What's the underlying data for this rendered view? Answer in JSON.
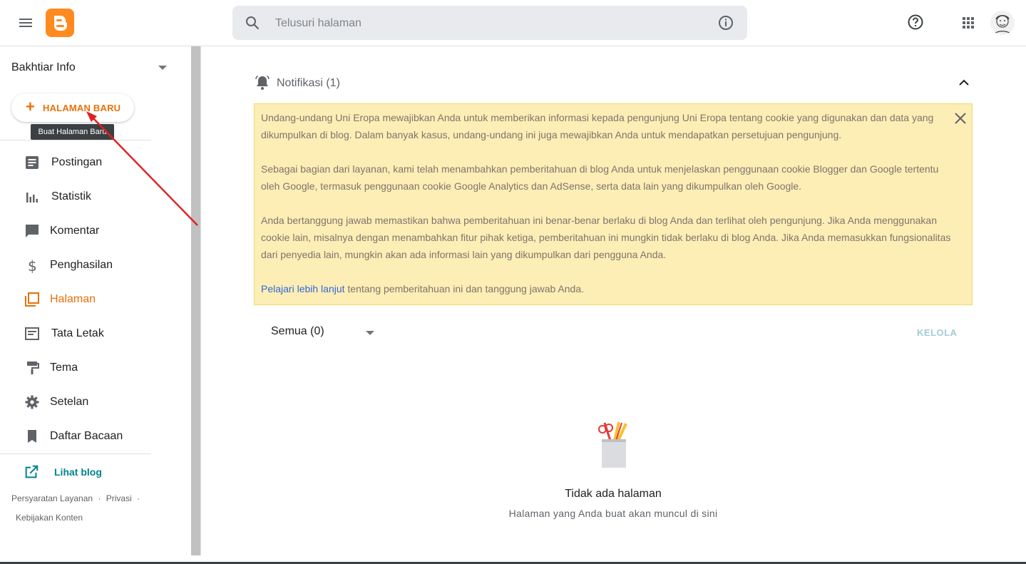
{
  "header": {
    "search_placeholder": "Telusuri halaman",
    "icons": [
      "menu-icon",
      "blogger-logo",
      "search-icon",
      "info-icon",
      "help-icon",
      "apps-icon",
      "avatar"
    ]
  },
  "sidebar": {
    "blog_name": "Bakhtiar Info",
    "new_page_label": "HALAMAN BARU",
    "tooltip": "Buat Halaman Baru",
    "items": [
      {
        "label": "Postingan",
        "icon": "posts-icon"
      },
      {
        "label": "Statistik",
        "icon": "stats-icon"
      },
      {
        "label": "Komentar",
        "icon": "comment-icon"
      },
      {
        "label": "Penghasilan",
        "icon": "dollar-icon"
      },
      {
        "label": "Halaman",
        "icon": "pages-icon"
      },
      {
        "label": "Tata Letak",
        "icon": "layout-icon"
      },
      {
        "label": "Tema",
        "icon": "paint-roller-icon"
      },
      {
        "label": "Setelan",
        "icon": "gear-icon"
      },
      {
        "label": "Daftar Bacaan",
        "icon": "bookmark-icon"
      }
    ],
    "active_item": "Halaman",
    "view_blog": "Lihat blog",
    "footer": {
      "terms": "Persyaratan Layanan",
      "privacy": "Privasi",
      "content_policy": "Kebijakan Konten",
      "sep": "·"
    }
  },
  "main": {
    "notifications_title": "Notifikasi (1)",
    "notice": {
      "p1": "Undang-undang Uni Eropa mewajibkan Anda untuk memberikan informasi kepada pengunjung Uni Eropa tentang cookie yang digunakan dan data yang dikumpulkan di blog. Dalam banyak kasus, undang-undang ini juga mewajibkan Anda untuk mendapatkan persetujuan pengunjung.",
      "p2": "Sebagai bagian dari layanan, kami telah menambahkan pemberitahuan di blog Anda untuk menjelaskan penggunaan cookie Blogger dan Google tertentu oleh Google, termasuk penggunaan cookie Google Analytics dan AdSense, serta data lain yang dikumpulkan oleh Google.",
      "p3": "Anda bertanggung jawab memastikan bahwa pemberitahuan ini benar-benar berlaku di blog Anda dan terlihat oleh pengunjung. Jika Anda menggunakan cookie lain, misalnya dengan menambahkan fitur pihak ketiga, pemberitahuan ini mungkin tidak berlaku di blog Anda. Jika Anda memasukkan fungsionalitas dari penyedia lain, mungkin akan ada informasi lain yang dikumpulkan dari pengguna Anda.",
      "link": "Pelajari lebih lanjut",
      "p4_rest": " tentang pemberitahuan ini dan tanggung jawab Anda."
    },
    "filter_label": "Semua (0)",
    "manage_label": "KELOLA",
    "empty_title": "Tidak ada halaman",
    "empty_subtitle": "Halaman yang Anda buat akan muncul di sini"
  },
  "colors": {
    "accent": "#e8710a",
    "notice_bg": "#fdeeb6",
    "link": "#3367d6",
    "view_blog": "#00838f"
  }
}
